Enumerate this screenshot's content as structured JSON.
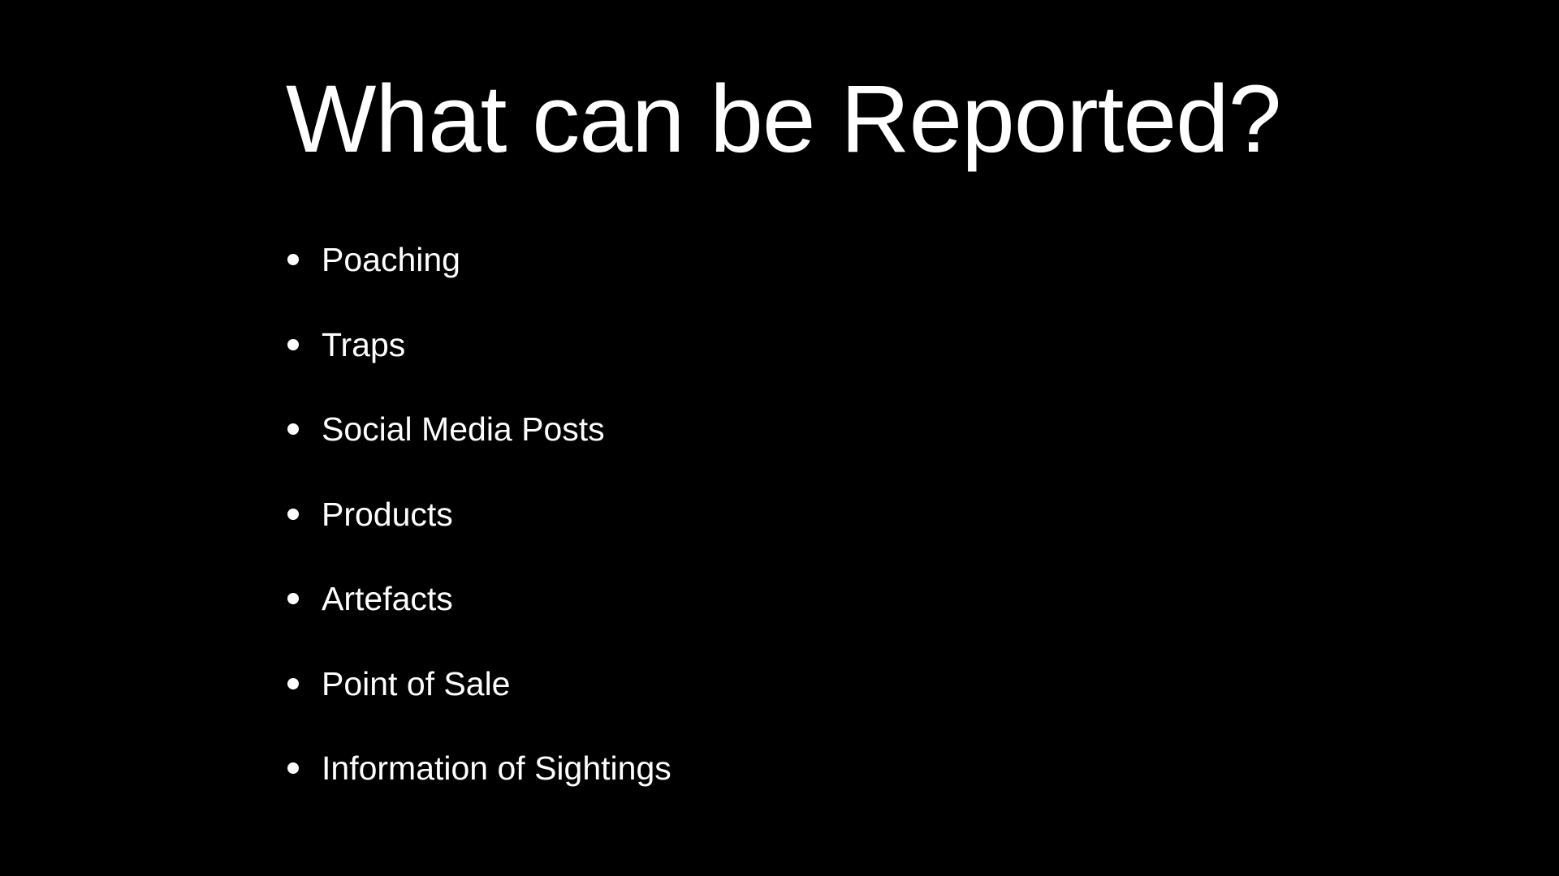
{
  "slide": {
    "title": "What can be Reported?",
    "bullets": [
      "Poaching",
      "Traps",
      "Social Media Posts",
      "Products",
      "Artefacts",
      "Point of Sale",
      "Information of Sightings"
    ]
  },
  "colors": {
    "background": "#000000",
    "text": "#ffffff"
  }
}
